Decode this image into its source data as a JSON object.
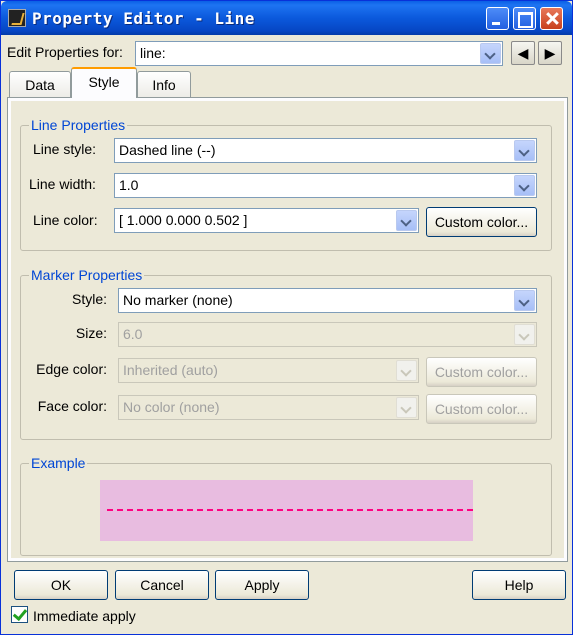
{
  "window": {
    "title": "Property Editor - Line"
  },
  "edit_properties": {
    "label": "Edit Properties for:",
    "value": "line:"
  },
  "tabs": [
    {
      "label": "Data"
    },
    {
      "label": "Style"
    },
    {
      "label": "Info"
    }
  ],
  "active_tab": "Style",
  "line_properties": {
    "title": "Line Properties",
    "style_label": "Line style:",
    "style_value": "Dashed line (--)",
    "width_label": "Line width:",
    "width_value": "1.0",
    "color_label": "Line color:",
    "color_value": "[ 1.000 0.000 0.502 ]",
    "custom_color_label": "Custom color..."
  },
  "marker_properties": {
    "title": "Marker Properties",
    "style_label": "Style:",
    "style_value": "No marker (none)",
    "size_label": "Size:",
    "size_value": "6.0",
    "edge_label": "Edge color:",
    "edge_value": "Inherited (auto)",
    "face_label": "Face color:",
    "face_value": "No color (none)",
    "custom_color_label": "Custom color..."
  },
  "example": {
    "title": "Example",
    "line_color": "#ff0080",
    "background_color": "#e8bce0"
  },
  "buttons": {
    "ok": "OK",
    "cancel": "Cancel",
    "apply": "Apply",
    "help": "Help"
  },
  "immediate_apply": {
    "label": "Immediate apply",
    "checked": true
  }
}
